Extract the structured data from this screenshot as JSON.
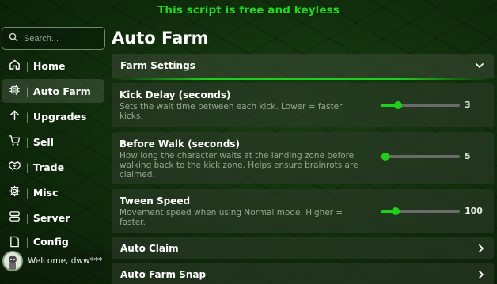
{
  "banner": "This script is free and keyless",
  "search": {
    "placeholder": "Search..."
  },
  "sidebar": {
    "items": [
      {
        "label": "| Home",
        "icon": "home-icon",
        "active": false
      },
      {
        "label": "| Auto Farm",
        "icon": "cpu-icon",
        "active": true
      },
      {
        "label": "| Upgrades",
        "icon": "arrow-up-icon",
        "active": false
      },
      {
        "label": "| Sell",
        "icon": "cart-icon",
        "active": false
      },
      {
        "label": "| Trade",
        "icon": "handshake-icon",
        "active": false
      },
      {
        "label": "| Misc",
        "icon": "gear-icon",
        "active": false
      },
      {
        "label": "| Server",
        "icon": "server-icon",
        "active": false
      },
      {
        "label": "| Config",
        "icon": "file-icon",
        "active": false
      }
    ],
    "welcome": "Welcome, dww***"
  },
  "page_title": "Auto Farm",
  "section": {
    "title": "Farm Settings",
    "expanded": true
  },
  "settings": [
    {
      "title": "Kick Delay (seconds)",
      "desc": "Sets the wait time between each kick. Lower = faster kicks.",
      "value": "3",
      "fraction": 0.22
    },
    {
      "title": "Before Walk (seconds)",
      "desc": "How long the character waits at the landing zone before walking back to the kick zone. Helps ensure brainrots are claimed.",
      "value": "5",
      "fraction": 0.06
    },
    {
      "title": "Tween Speed",
      "desc": "Movement speed when using Normal mode. Higher = faster.",
      "value": "100",
      "fraction": 0.19
    }
  ],
  "rows": [
    {
      "label": "Auto Claim"
    },
    {
      "label": "Auto Farm Snap"
    }
  ],
  "colors": {
    "accent": "#1fd01b",
    "banner": "#22d81e"
  }
}
